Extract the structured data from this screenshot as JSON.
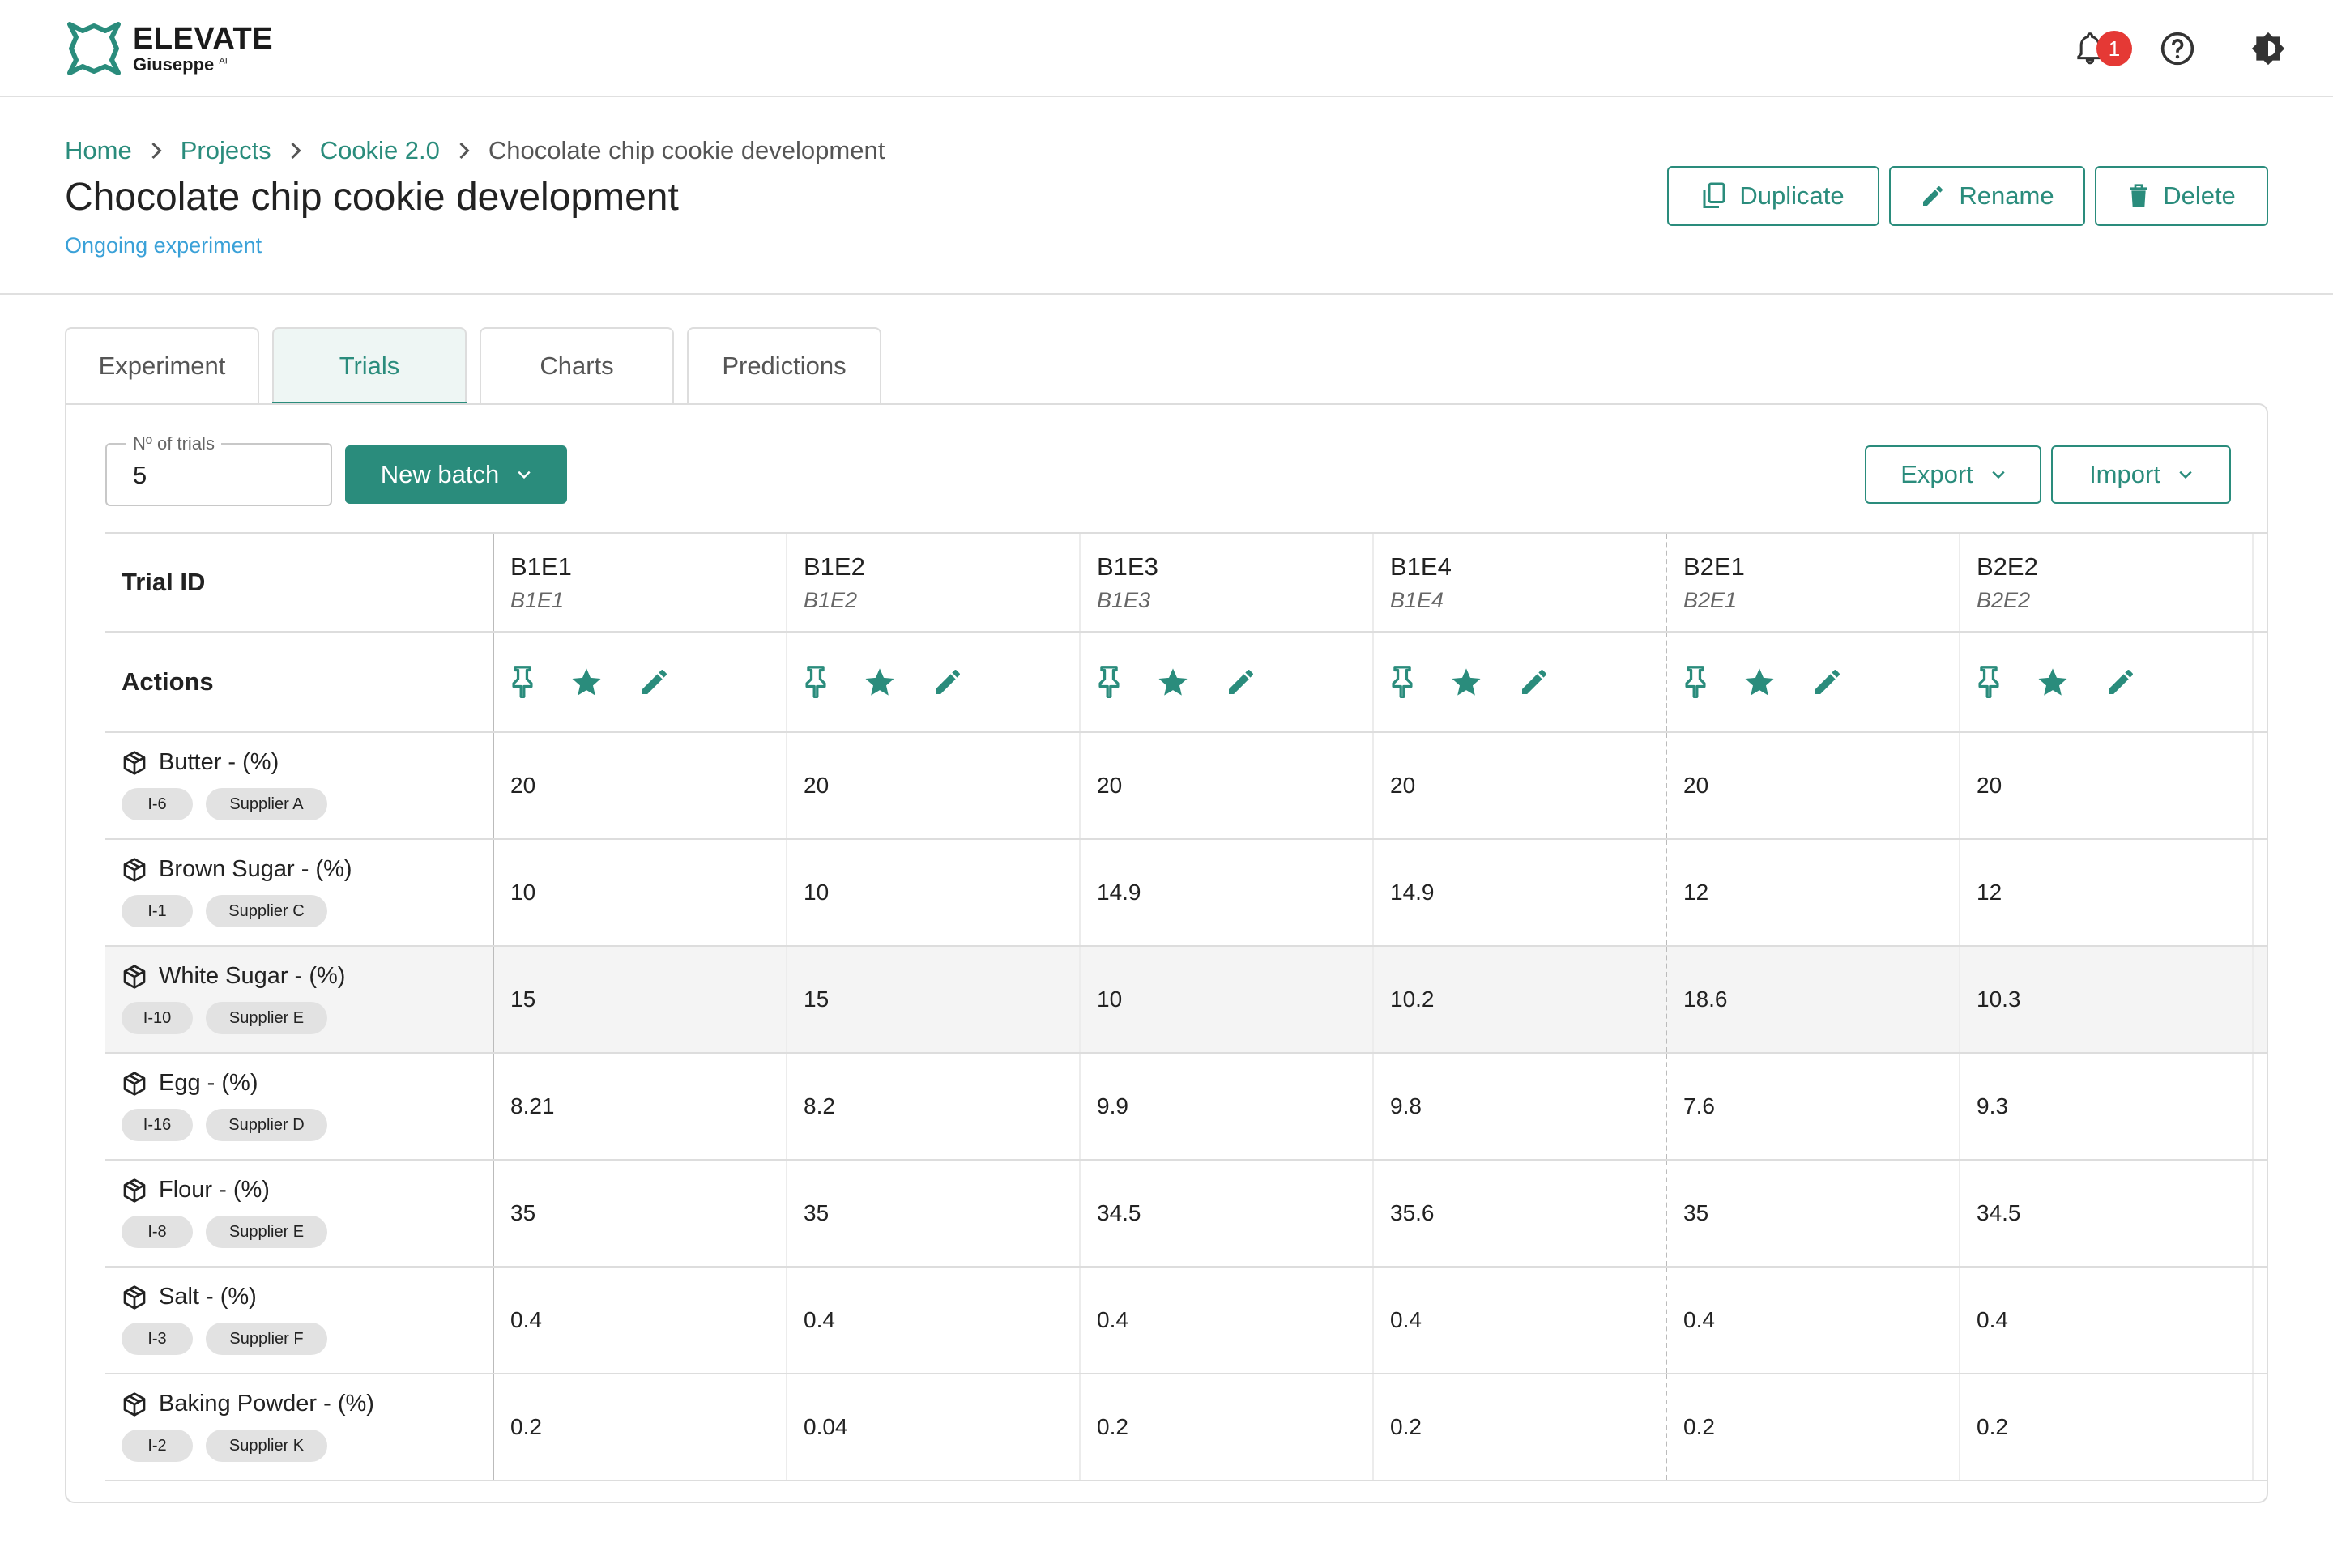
{
  "app": {
    "brand": "ELEVATE",
    "sub_brand": "Giuseppe",
    "sub_brand_mark": "AI",
    "notifications": "1",
    "icons": [
      "bell-icon",
      "help-icon",
      "theme-icon",
      "logout-icon"
    ]
  },
  "breadcrumb": [
    "Home",
    "Projects",
    "Cookie 2.0",
    "Chocolate chip cookie development"
  ],
  "page": {
    "title": "Chocolate chip cookie development",
    "status": "Ongoing experiment"
  },
  "actions": {
    "duplicate": "Duplicate",
    "rename": "Rename",
    "delete": "Delete"
  },
  "tabs": [
    {
      "label": "Experiment",
      "active": false
    },
    {
      "label": "Trials",
      "active": true
    },
    {
      "label": "Charts",
      "active": false
    },
    {
      "label": "Predictions",
      "active": false
    }
  ],
  "toolbar": {
    "trials_label": "Nº of trials",
    "trials_value": "5",
    "new_batch": "New batch",
    "export": "Export",
    "import": "Import"
  },
  "table": {
    "trial_id_header": "Trial ID",
    "actions_header": "Actions",
    "trials": [
      {
        "id": "B1E1",
        "sub": "B1E1"
      },
      {
        "id": "B1E2",
        "sub": "B1E2"
      },
      {
        "id": "B1E3",
        "sub": "B1E3"
      },
      {
        "id": "B1E4",
        "sub": "B1E4"
      },
      {
        "id": "B2E1",
        "sub": "B2E1"
      },
      {
        "id": "B2E2",
        "sub": "B2E2"
      }
    ],
    "ingredients": [
      {
        "name": "Butter - (%)",
        "code": "I-6",
        "supplier": "Supplier A",
        "values": [
          "20",
          "20",
          "20",
          "20",
          "20",
          "20"
        ]
      },
      {
        "name": "Brown Sugar - (%)",
        "code": "I-1",
        "supplier": "Supplier C",
        "values": [
          "10",
          "10",
          "14.9",
          "14.9",
          "12",
          "12"
        ]
      },
      {
        "name": "White Sugar - (%)",
        "code": "I-10",
        "supplier": "Supplier E",
        "values": [
          "15",
          "15",
          "10",
          "10.2",
          "18.6",
          "10.3"
        ]
      },
      {
        "name": "Egg - (%)",
        "code": "I-16",
        "supplier": "Supplier D",
        "values": [
          "8.21",
          "8.2",
          "9.9",
          "9.8",
          "7.6",
          "9.3"
        ]
      },
      {
        "name": "Flour - (%)",
        "code": "I-8",
        "supplier": "Supplier E",
        "values": [
          "35",
          "35",
          "34.5",
          "35.6",
          "35",
          "34.5"
        ]
      },
      {
        "name": "Salt - (%)",
        "code": "I-3",
        "supplier": "Supplier F",
        "values": [
          "0.4",
          "0.4",
          "0.4",
          "0.4",
          "0.4",
          "0.4"
        ]
      },
      {
        "name": "Baking Powder - (%)",
        "code": "I-2",
        "supplier": "Supplier K",
        "values": [
          "0.2",
          "0.04",
          "0.2",
          "0.2",
          "0.2",
          "0.2"
        ]
      }
    ]
  },
  "colors": {
    "accent": "#2a8c7c",
    "link_blue": "#3aa1d8",
    "badge_red": "#e53935"
  }
}
